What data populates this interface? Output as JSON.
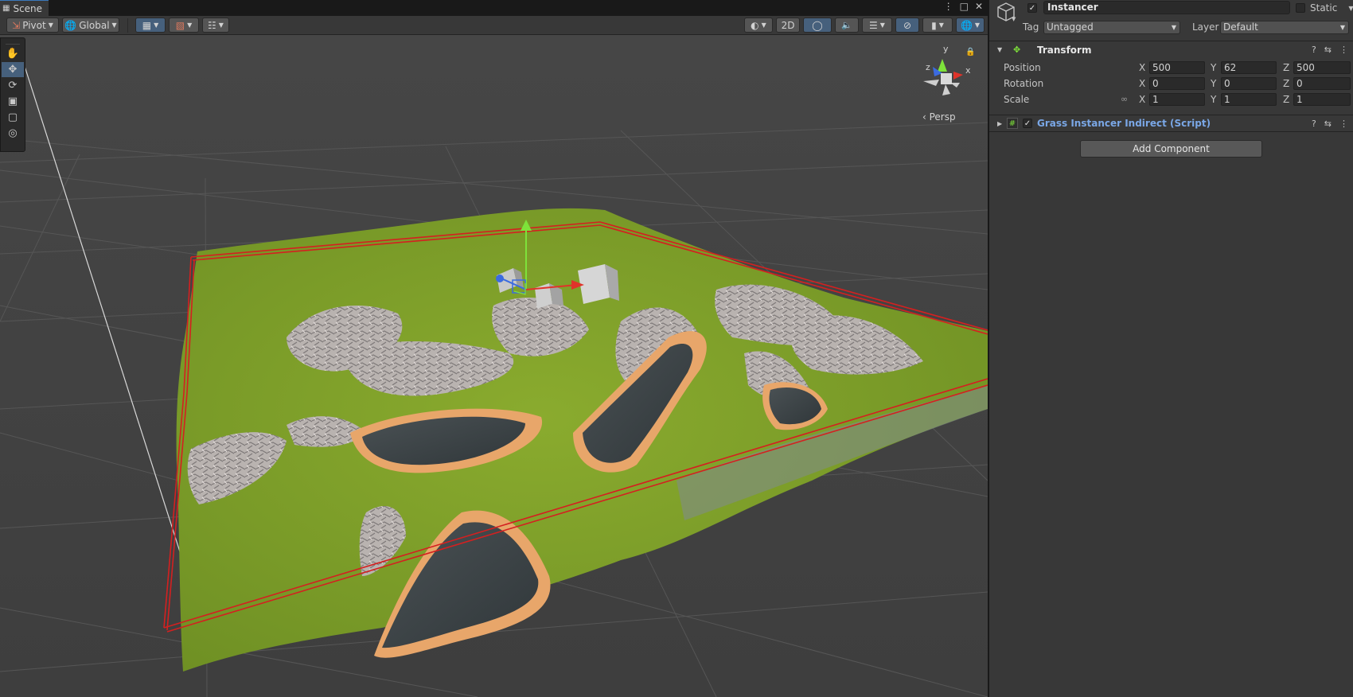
{
  "scene": {
    "tab_label": "Scene",
    "toolbar": {
      "pivot_label": "Pivot",
      "global_label": "Global",
      "mode_2d_label": "2D"
    },
    "persp_label": "‹ Persp",
    "gizmo_axes": {
      "y": "y",
      "z": "z",
      "x": "x"
    }
  },
  "inspector": {
    "object_name": "Instancer",
    "active": true,
    "static_label": "Static",
    "tag_label": "Tag",
    "tag_value": "Untagged",
    "layer_label": "Layer",
    "layer_value": "Default",
    "transform": {
      "title": "Transform",
      "position_label": "Position",
      "rotation_label": "Rotation",
      "scale_label": "Scale",
      "axis_x": "X",
      "axis_y": "Y",
      "axis_z": "Z",
      "position": {
        "x": "500",
        "y": "62",
        "z": "500"
      },
      "rotation": {
        "x": "0",
        "y": "0",
        "z": "0"
      },
      "scale": {
        "x": "1",
        "y": "1",
        "z": "1"
      }
    },
    "script_component": {
      "title": "Grass Instancer Indirect (Script)",
      "enabled": true
    },
    "add_component_label": "Add Component"
  },
  "colors": {
    "accent_blue": "#46607c",
    "script_link": "#7aa7e6",
    "terrain_grass": "#7e9f2a",
    "water": "#3c4246",
    "sand": "#e8a66a",
    "bounds_red": "#d42020"
  }
}
